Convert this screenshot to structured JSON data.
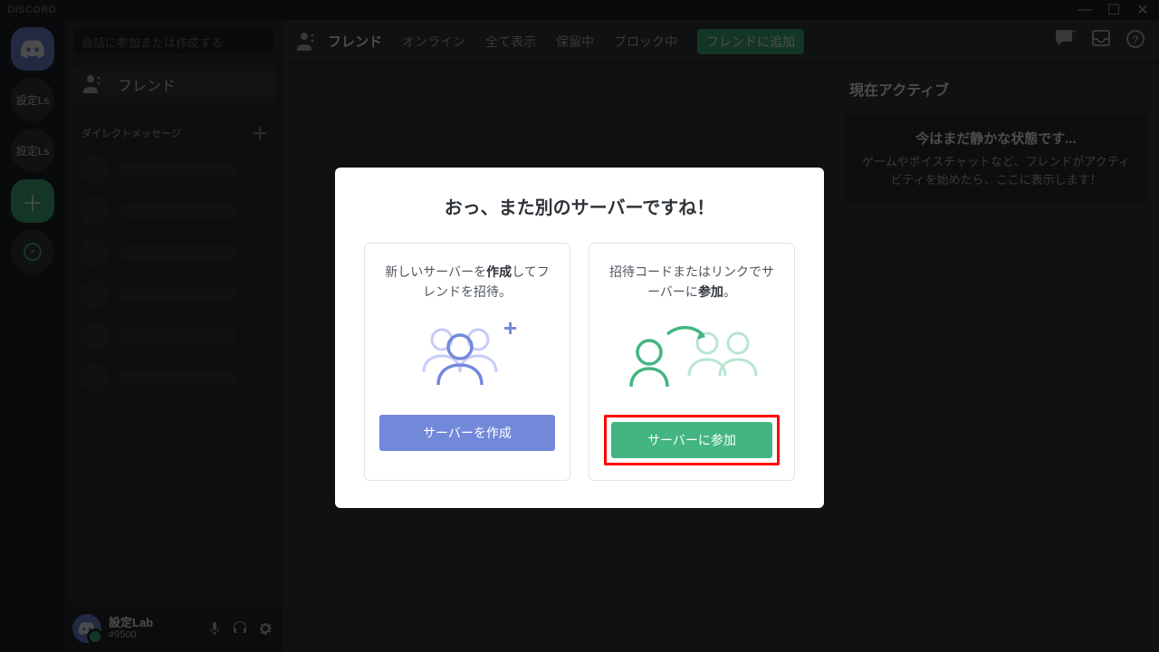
{
  "app": {
    "name": "DISCORD"
  },
  "titlebar": {
    "minimize": "—",
    "maximize": "☐",
    "close": "✕"
  },
  "sidebar": {
    "search_placeholder": "会話に参加または作成する",
    "friends_label": "フレンド",
    "dm_header": "ダイレクトメッセージ",
    "add_dm": "＋",
    "guild_labels": [
      "設定Ls",
      "設定Ls"
    ],
    "user": {
      "name": "設定Lab",
      "tag": "#9500"
    }
  },
  "header": {
    "title": "フレンド",
    "tabs": [
      "オンライン",
      "全て表示",
      "保留中",
      "ブロック中"
    ],
    "add_friend": "フレンドに追加"
  },
  "activity": {
    "title": "現在アクティブ",
    "card_title": "今はまだ静かな状態です...",
    "card_desc": "ゲームやボイスチャットなど、フレンドがアクティビティを始めたら、ここに表示します！"
  },
  "modal": {
    "title": "おっ、また別のサーバーですね！",
    "create": {
      "desc_pre": "新しいサーバーを",
      "desc_bold": "作成",
      "desc_post": "してフレンドを招待。",
      "button": "サーバーを作成"
    },
    "join": {
      "desc_pre": "招待コードまたはリンクでサーバーに",
      "desc_bold": "参加",
      "desc_post": "。",
      "button": "サーバーに参加"
    }
  }
}
